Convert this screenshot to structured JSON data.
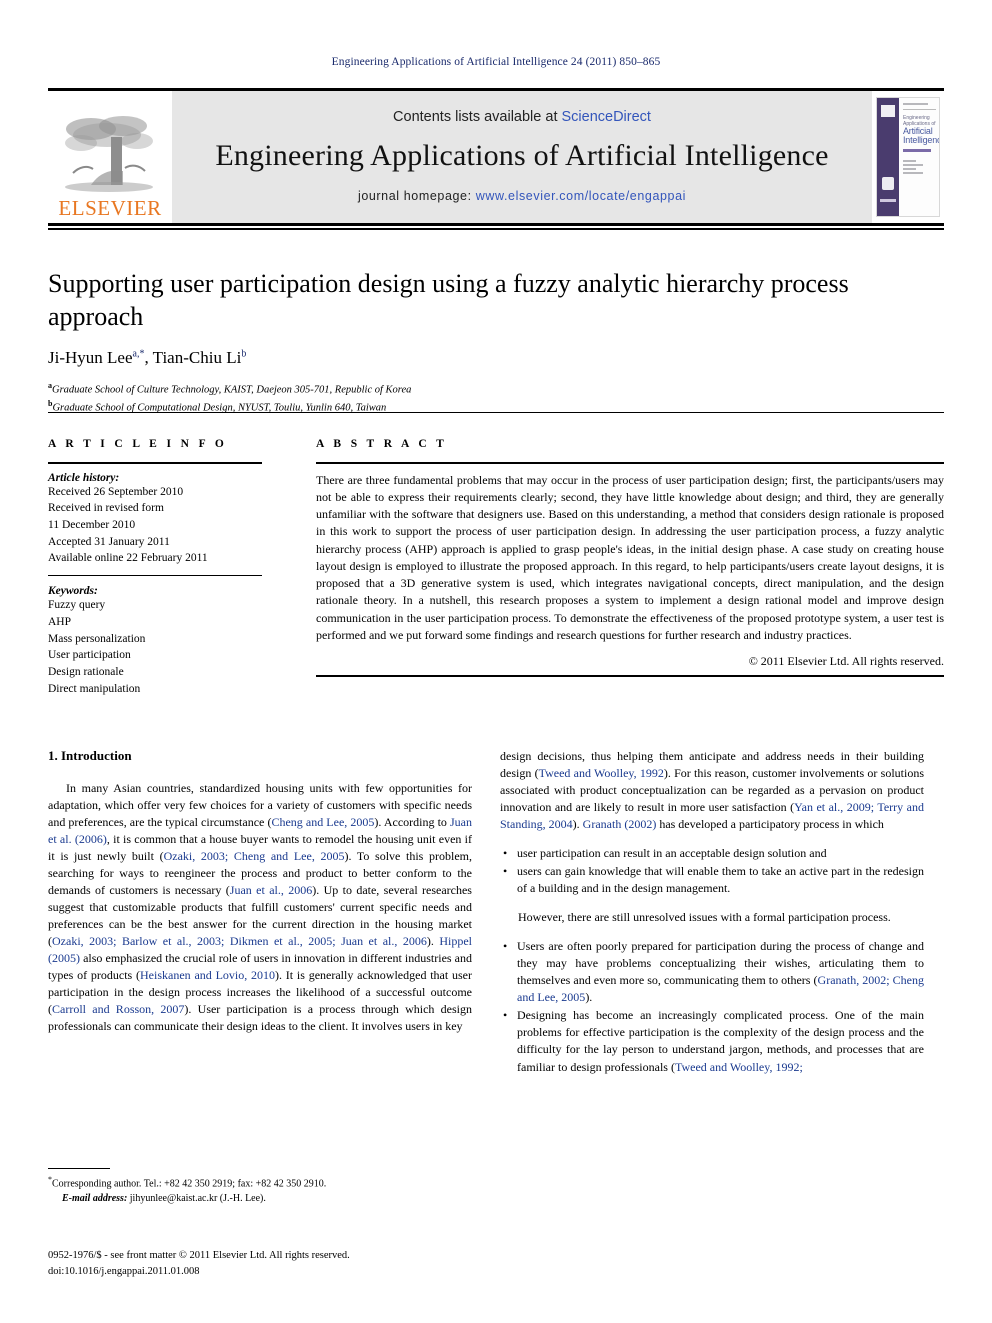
{
  "running_head": "Engineering Applications of Artificial Intelligence 24 (2011) 850–865",
  "masthead": {
    "publisher_wordmark": "ELSEVIER",
    "contents_prefix": "Contents lists available at ",
    "contents_link": "ScienceDirect",
    "journal_name": "Engineering Applications of Artificial Intelligence",
    "homepage_prefix": "journal homepage: ",
    "homepage_url": "www.elsevier.com/locate/engappai",
    "cover": {
      "line1": "Engineering Applications of",
      "line2": "Artificial",
      "line3": "Intelligence"
    },
    "colors": {
      "band_background": "#e6e6e6",
      "link_blue": "#3355bb",
      "elsevier_orange": "#e87722",
      "cover_purple": "#4a3c6e"
    }
  },
  "title": "Supporting user participation design using a fuzzy analytic hierarchy process approach",
  "authors": {
    "author1_name": "Ji-Hyun Lee",
    "author1_sup": "a,*",
    "separator": ", ",
    "author2_name": "Tian-Chiu Li",
    "author2_sup": "b"
  },
  "affiliations": [
    {
      "marker": "a",
      "text": "Graduate School of Culture Technology, KAIST, Daejeon 305-701, Republic of Korea"
    },
    {
      "marker": "b",
      "text": "Graduate School of Computational Design, NYUST, Touliu, Yunlin 640, Taiwan"
    }
  ],
  "article_info": {
    "heading": "A R T I C L E   I N F O",
    "history_label": "Article history:",
    "history": [
      "Received 26 September 2010",
      "Received in revised form",
      "11 December 2010",
      "Accepted 31 January 2011",
      "Available online 22 February 2011"
    ],
    "keywords_label": "Keywords:",
    "keywords": [
      "Fuzzy query",
      "AHP",
      "Mass personalization",
      "User participation",
      "Design rationale",
      "Direct manipulation"
    ]
  },
  "abstract": {
    "heading": "A B S T R A C T",
    "text": "There are three fundamental problems that may occur in the process of user participation design; first, the participants/users may not be able to express their requirements clearly; second, they have little knowledge about design; and third, they are generally unfamiliar with the software that designers use. Based on this understanding, a method that considers design rationale is proposed in this work to support the process of user participation design. In addressing the user participation process, a fuzzy analytic hierarchy process (AHP) approach is applied to grasp people's ideas, in the initial design phase. A case study on creating house layout design is employed to illustrate the proposed approach. In this regard, to help participants/users create layout designs, it is proposed that a 3D generative system is used, which integrates navigational concepts, direct manipulation, and the design rationale theory. In a nutshell, this research proposes a system to implement a design rational model and improve design communication in the user participation process. To demonstrate the effectiveness of the proposed prototype system, a user test is performed and we put forward some findings and research questions for further research and industry practices.",
    "copyright": "© 2011 Elsevier Ltd. All rights reserved."
  },
  "body": {
    "section_number_title": "1.  Introduction",
    "left_paragraph_1_a": "In many Asian countries, standardized housing units with few opportunities for adaptation, which offer very few choices for a variety of customers with specific needs and preferences, are the typical circumstance (",
    "left_ref_1": "Cheng and Lee, 2005",
    "left_paragraph_1_b": "). According to ",
    "left_ref_2": "Juan et al. (2006)",
    "left_paragraph_1_c": ", it is common that a house buyer wants to remodel the housing unit even if it is just newly built (",
    "left_ref_3": "Ozaki, 2003; Cheng and Lee, 2005",
    "left_paragraph_1_d": "). To solve this problem, searching for ways to reengineer the process and product to better conform to the demands of customers is necessary (",
    "left_ref_4": "Juan et al., 2006",
    "left_paragraph_1_e": "). Up to date, several researches suggest that customizable products that fulfill customers' current specific needs and preferences can be the best answer for the current direction in the housing market (",
    "left_ref_5": "Ozaki, 2003; Barlow et al., 2003; Dikmen et al., 2005; Juan et al., 2006",
    "left_paragraph_1_f": "). ",
    "left_ref_6": "Hippel (2005)",
    "left_paragraph_1_g": " also emphasized the crucial role of users in innovation in different industries and types of products (",
    "left_ref_7": "Heiskanen and Lovio, 2010",
    "left_paragraph_1_h": "). It is generally acknowledged that user participation in the design process increases the likelihood of a successful outcome (",
    "left_ref_8": "Carroll and Rosson, 2007",
    "left_paragraph_1_i": "). User participation is a process through which design professionals can communicate their design ideas to the client. It involves users in key",
    "right_paragraph_1_a": "design decisions, thus helping them anticipate and address needs in their building design (",
    "right_ref_1": "Tweed and Woolley, 1992",
    "right_paragraph_1_b": "). For this reason, customer involvements or solutions associated with product conceptualization can be regarded as a pervasion on product innovation and are likely to result in more user satisfaction (",
    "right_ref_2": "Yan et al., 2009; Terry and Standing, 2004",
    "right_paragraph_1_c": "). ",
    "right_ref_3": "Granath (2002)",
    "right_paragraph_1_d": " has developed a participatory process in which",
    "bullets_1": [
      "user participation can result in an acceptable design solution and",
      "users can gain knowledge that will enable them to take an active part in the redesign of a building and in the design management."
    ],
    "right_paragraph_2": "However, there are still unresolved issues with a formal participation process.",
    "bullet_2_a": "Users are often poorly prepared for participation during the process of change and they may have problems conceptualizing their wishes, articulating them to themselves and even more so, communicating them to others (",
    "bullet_2_ref": "Granath, 2002; Cheng and Lee, 2005",
    "bullet_2_b": ").",
    "bullet_3_a": "Designing has become an increasingly complicated process. One of the main problems for effective participation is the complexity of the design process and the difficulty for the lay person to understand jargon, methods, and processes that are familiar to design professionals (",
    "bullet_3_ref": "Tweed and Woolley, 1992;"
  },
  "footnote": {
    "marker": "*",
    "corresponding": "Corresponding author. Tel.: +82 42 350 2919; fax: +82 42 350 2910.",
    "email_label": "E-mail address:",
    "email_value": " jihyunlee@kaist.ac.kr (J.-H. Lee)."
  },
  "footer": {
    "issn_line": "0952-1976/$ - see front matter © 2011 Elsevier Ltd. All rights reserved.",
    "doi_line": "doi:10.1016/j.engappai.2011.01.008"
  }
}
